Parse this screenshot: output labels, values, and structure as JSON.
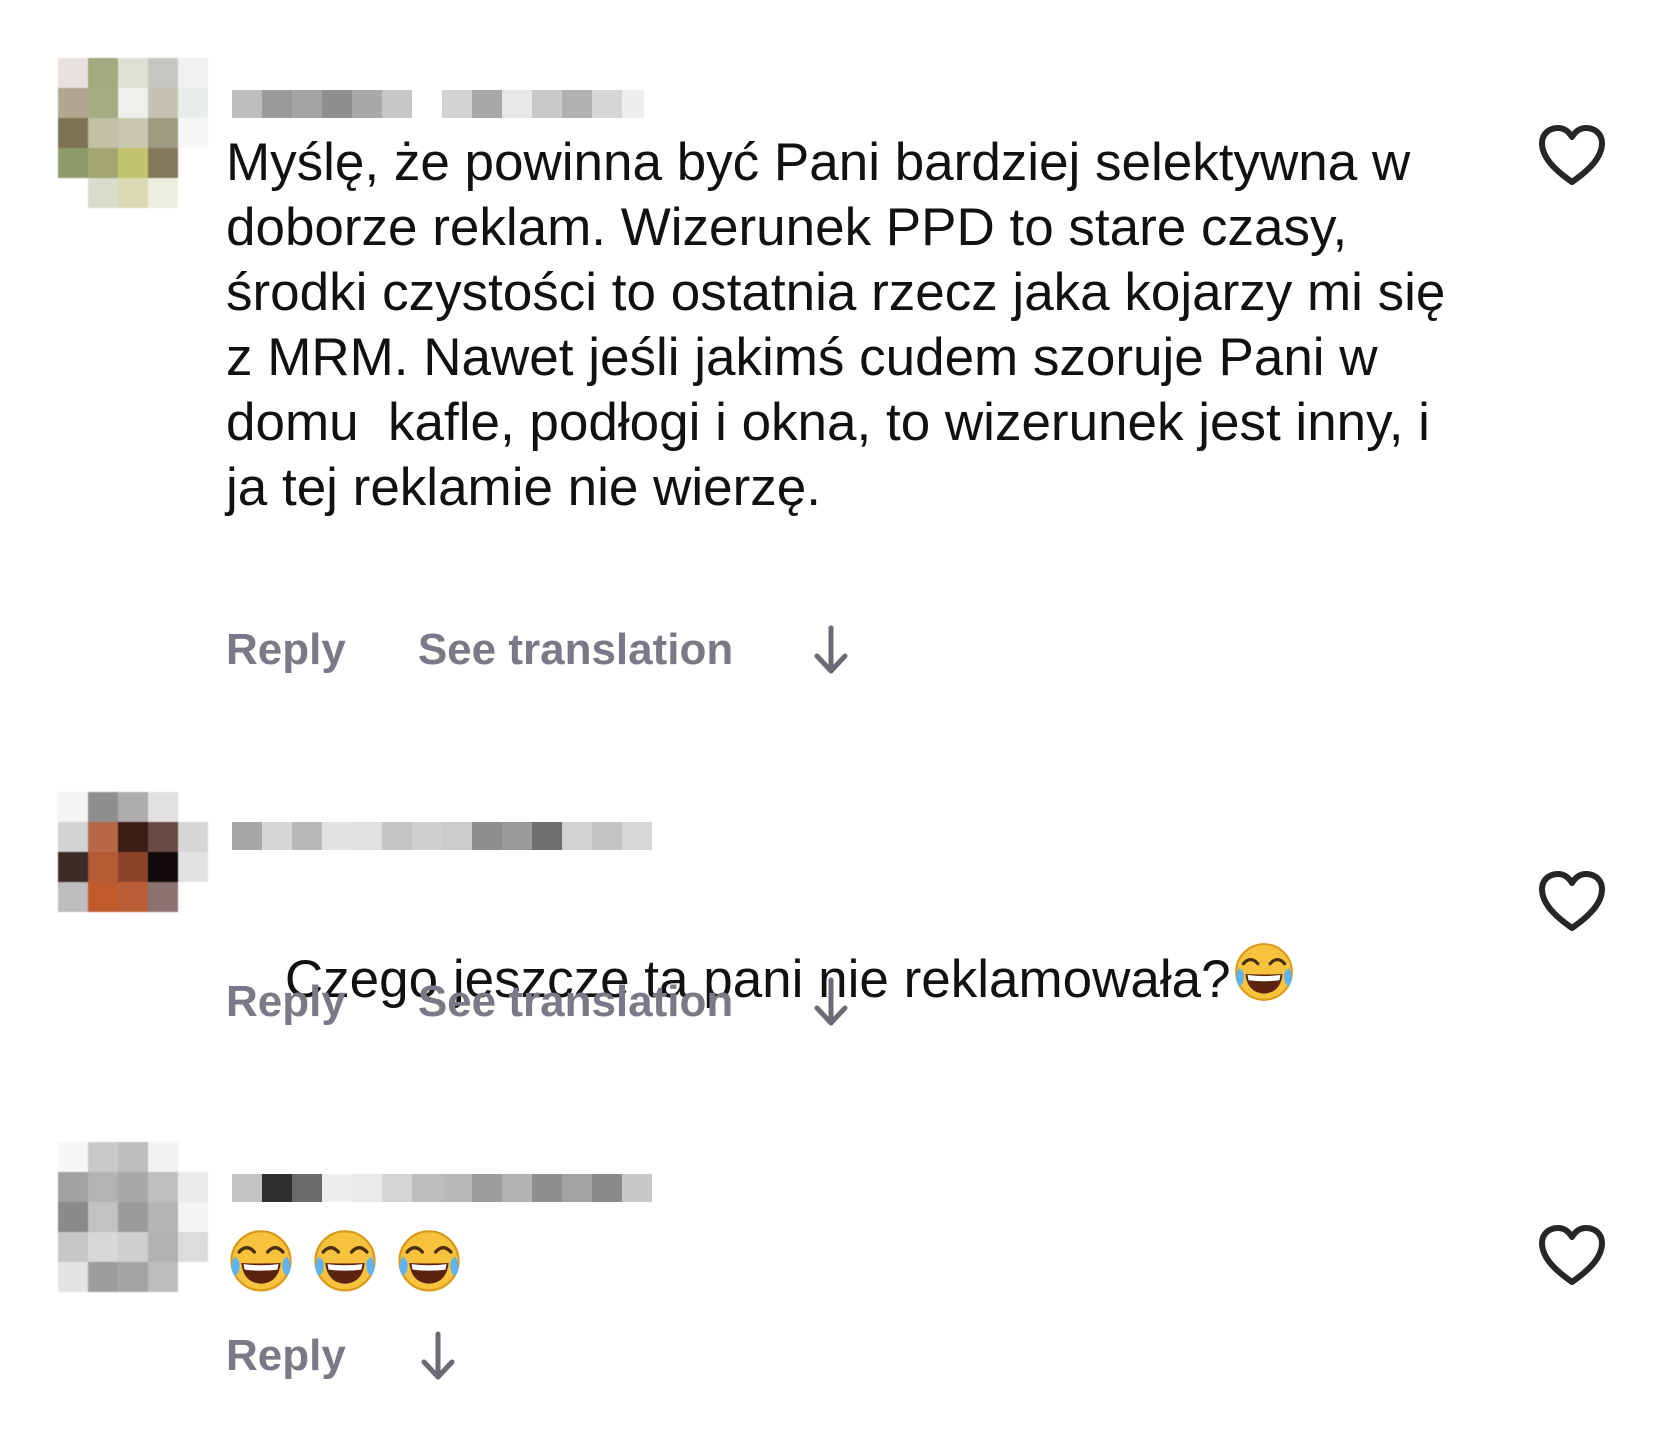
{
  "comments": [
    {
      "text": "Myślę, że powinna być Pani bardziej selektywna w doborze reklam. Wizerunek PPD to stare czasy, środki czystości to ostatnia rzecz jaka kojarzy mi się z MRM. Nawet jeśli jakimś cudem szoruje Pani w domu  kafle, podłogi i okna, to wizerunek jest inny, i ja tej reklamie nie wierzę.",
      "reply_label": "Reply",
      "translation_label": "See translation",
      "avatar_icon": "pixelated-avatar-icon",
      "like_icon": "heart-outline-icon",
      "more_icon": "arrow-down-icon"
    },
    {
      "text": "Czego jeszcze ta pani nie reklamowała?",
      "emoji": "face-with-tears-of-joy-icon",
      "reply_label": "Reply",
      "translation_label": "See translation",
      "avatar_icon": "pixelated-avatar-icon",
      "like_icon": "heart-outline-icon",
      "more_icon": "arrow-down-icon"
    },
    {
      "emojis": [
        "face-with-tears-of-joy-icon",
        "face-with-tears-of-joy-icon",
        "face-with-tears-of-joy-icon"
      ],
      "reply_label": "Reply",
      "avatar_icon": "pixelated-avatar-icon",
      "like_icon": "heart-outline-icon",
      "more_icon": "arrow-down-icon"
    }
  ],
  "colors": {
    "text": "#111111",
    "secondary": "#7a7a86",
    "icon": "#262626",
    "background": "#ffffff"
  }
}
